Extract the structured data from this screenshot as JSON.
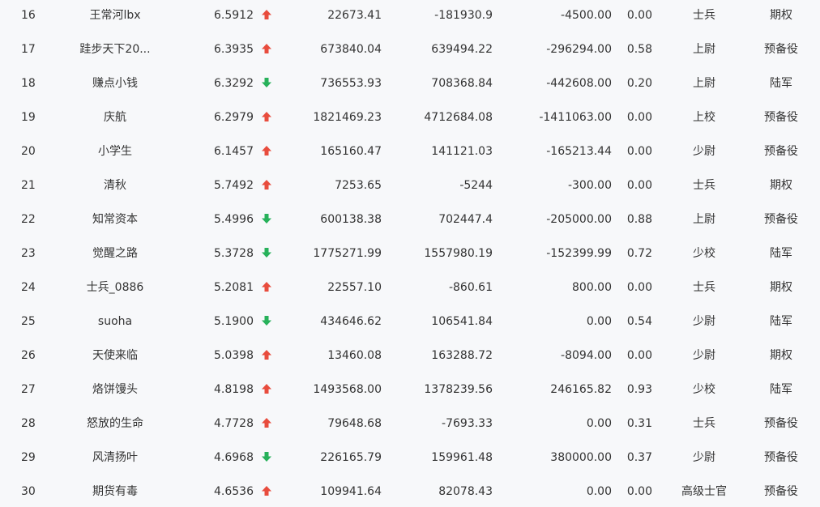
{
  "colors": {
    "up": "#e84c3d",
    "down": "#27b15a",
    "background": "#f7f8fa",
    "text": "#333333"
  },
  "rows": [
    {
      "rank": "16",
      "name": "王常河lbx",
      "score": "6.5912",
      "trend": "up",
      "v1": "22673.41",
      "v2": "-181930.9",
      "v3": "-4500.00",
      "v4": "0.00",
      "rank_title": "士兵",
      "category": "期权"
    },
    {
      "rank": "17",
      "name": "跬步天下20...",
      "score": "6.3935",
      "trend": "up",
      "v1": "673840.04",
      "v2": "639494.22",
      "v3": "-296294.00",
      "v4": "0.58",
      "rank_title": "上尉",
      "category": "预备役"
    },
    {
      "rank": "18",
      "name": "赚点小钱",
      "score": "6.3292",
      "trend": "down",
      "v1": "736553.93",
      "v2": "708368.84",
      "v3": "-442608.00",
      "v4": "0.20",
      "rank_title": "上尉",
      "category": "陆军"
    },
    {
      "rank": "19",
      "name": "庆航",
      "score": "6.2979",
      "trend": "up",
      "v1": "1821469.23",
      "v2": "4712684.08",
      "v3": "-1411063.00",
      "v4": "0.00",
      "rank_title": "上校",
      "category": "预备役"
    },
    {
      "rank": "20",
      "name": "小学生",
      "score": "6.1457",
      "trend": "up",
      "v1": "165160.47",
      "v2": "141121.03",
      "v3": "-165213.44",
      "v4": "0.00",
      "rank_title": "少尉",
      "category": "预备役"
    },
    {
      "rank": "21",
      "name": "清秋",
      "score": "5.7492",
      "trend": "up",
      "v1": "7253.65",
      "v2": "-5244",
      "v3": "-300.00",
      "v4": "0.00",
      "rank_title": "士兵",
      "category": "期权"
    },
    {
      "rank": "22",
      "name": "知常资本",
      "score": "5.4996",
      "trend": "down",
      "v1": "600138.38",
      "v2": "702447.4",
      "v3": "-205000.00",
      "v4": "0.88",
      "rank_title": "上尉",
      "category": "预备役"
    },
    {
      "rank": "23",
      "name": "觉醒之路",
      "score": "5.3728",
      "trend": "down",
      "v1": "1775271.99",
      "v2": "1557980.19",
      "v3": "-152399.99",
      "v4": "0.72",
      "rank_title": "少校",
      "category": "陆军"
    },
    {
      "rank": "24",
      "name": "士兵_0886",
      "score": "5.2081",
      "trend": "up",
      "v1": "22557.10",
      "v2": "-860.61",
      "v3": "800.00",
      "v4": "0.00",
      "rank_title": "士兵",
      "category": "期权"
    },
    {
      "rank": "25",
      "name": "suoha",
      "score": "5.1900",
      "trend": "down",
      "v1": "434646.62",
      "v2": "106541.84",
      "v3": "0.00",
      "v4": "0.54",
      "rank_title": "少尉",
      "category": "陆军"
    },
    {
      "rank": "26",
      "name": "天使来临",
      "score": "5.0398",
      "trend": "up",
      "v1": "13460.08",
      "v2": "163288.72",
      "v3": "-8094.00",
      "v4": "0.00",
      "rank_title": "少尉",
      "category": "期权"
    },
    {
      "rank": "27",
      "name": "烙饼馒头",
      "score": "4.8198",
      "trend": "up",
      "v1": "1493568.00",
      "v2": "1378239.56",
      "v3": "246165.82",
      "v4": "0.93",
      "rank_title": "少校",
      "category": "陆军"
    },
    {
      "rank": "28",
      "name": "怒放的生命",
      "score": "4.7728",
      "trend": "up",
      "v1": "79648.68",
      "v2": "-7693.33",
      "v3": "0.00",
      "v4": "0.31",
      "rank_title": "士兵",
      "category": "预备役"
    },
    {
      "rank": "29",
      "name": "风清扬叶",
      "score": "4.6968",
      "trend": "down",
      "v1": "226165.79",
      "v2": "159961.48",
      "v3": "380000.00",
      "v4": "0.37",
      "rank_title": "少尉",
      "category": "预备役"
    },
    {
      "rank": "30",
      "name": "期货有毒",
      "score": "4.6536",
      "trend": "up",
      "v1": "109941.64",
      "v2": "82078.43",
      "v3": "0.00",
      "v4": "0.00",
      "rank_title": "高级士官",
      "category": "预备役"
    }
  ]
}
